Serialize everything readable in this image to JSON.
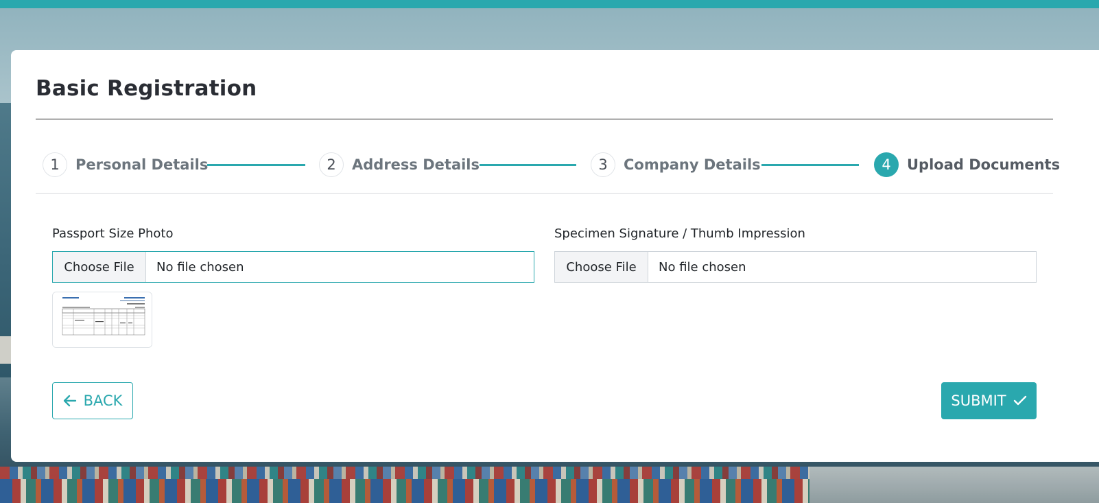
{
  "header": {
    "title": "Basic Registration"
  },
  "stepper": {
    "steps": [
      {
        "number": "1",
        "label": "Personal Details"
      },
      {
        "number": "2",
        "label": "Address Details"
      },
      {
        "number": "3",
        "label": "Company Details"
      },
      {
        "number": "4",
        "label": "Upload Documents"
      }
    ],
    "active_step": 4
  },
  "form": {
    "photo": {
      "label": "Passport Size Photo",
      "button": "Choose File",
      "status": "No file chosen"
    },
    "signature": {
      "label": "Specimen Signature / Thumb Impression",
      "button": "Choose File",
      "status": "No file chosen"
    }
  },
  "actions": {
    "back_label": "BACK",
    "submit_label": "SUBMIT"
  },
  "icons": {
    "back": "arrow-left-icon",
    "submit": "check-icon"
  },
  "colors": {
    "accent": "#2aa8ae",
    "title": "#2a2d34",
    "muted_step": "#6c757d"
  }
}
